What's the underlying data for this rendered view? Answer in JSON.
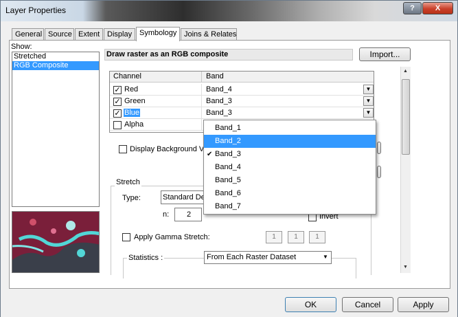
{
  "window": {
    "title": "Layer Properties",
    "help_label": "?",
    "close_label": "X"
  },
  "tabs": [
    {
      "label": "General",
      "active": false
    },
    {
      "label": "Source",
      "active": false
    },
    {
      "label": "Extent",
      "active": false
    },
    {
      "label": "Display",
      "active": false
    },
    {
      "label": "Symbology",
      "active": true
    },
    {
      "label": "Joins & Relates",
      "active": false
    }
  ],
  "show": {
    "label": "Show:",
    "items": [
      {
        "label": "Stretched",
        "selected": false
      },
      {
        "label": "RGB Composite",
        "selected": true
      }
    ]
  },
  "symbology": {
    "heading": "Draw raster as an RGB composite",
    "import_label": "Import...",
    "col_channel": "Channel",
    "col_band": "Band",
    "channels": [
      {
        "name": "Red",
        "checked": true,
        "band": "Band_4"
      },
      {
        "name": "Green",
        "checked": true,
        "band": "Band_3"
      },
      {
        "name": "Blue",
        "checked": true,
        "band": "Band_3"
      },
      {
        "name": "Alpha",
        "checked": false,
        "band": ""
      }
    ],
    "display_background_label": "Display Background Va",
    "stretch_label": "Stretch",
    "type_label": "Type:",
    "type_value": "Standard De",
    "n_label": "n:",
    "n_value": "2",
    "invert_label": "Invert",
    "gamma_label": "Apply Gamma Stretch:",
    "gamma_values": [
      "1",
      "1",
      "1"
    ],
    "statistics_label": "Statistics :",
    "statistics_value": "From Each Raster Dataset"
  },
  "band_dropdown": {
    "options": [
      {
        "label": "Band_1",
        "highlighted": false,
        "checked": false
      },
      {
        "label": "Band_2",
        "highlighted": true,
        "checked": false
      },
      {
        "label": "Band_3",
        "highlighted": false,
        "checked": true
      },
      {
        "label": "Band_4",
        "highlighted": false,
        "checked": false
      },
      {
        "label": "Band_5",
        "highlighted": false,
        "checked": false
      },
      {
        "label": "Band_6",
        "highlighted": false,
        "checked": false
      },
      {
        "label": "Band_7",
        "highlighted": false,
        "checked": false
      }
    ]
  },
  "buttons": {
    "ok": "OK",
    "cancel": "Cancel",
    "apply": "Apply"
  },
  "colors": {
    "selection": "#3399ff",
    "close_button": "#c9402a",
    "thumbnail_base": "#7a1f3a",
    "thumbnail_cyan": "#52d6d6"
  }
}
